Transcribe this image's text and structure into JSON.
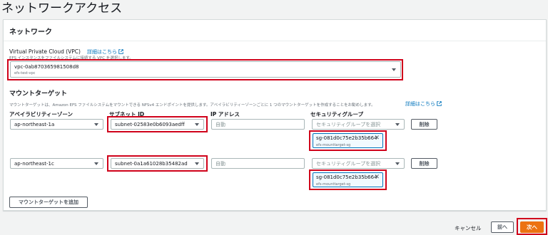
{
  "page": {
    "title": "ネットワークアクセス"
  },
  "network": {
    "header": "ネットワーク",
    "vpc_label": "Virtual Private Cloud (VPC)",
    "vpc_info_link": "詳細はこちら",
    "vpc_description": "EFS インスタンスをファイルシステムに接続する VPC を選択します。",
    "vpc_value": "vpc-0ab870365981508d8",
    "vpc_name": "efs-test-vpc"
  },
  "mount_targets": {
    "title": "マウントターゲット",
    "description": "マウントターゲットは、Amazon EFS ファイルシステムをマウントできる NFSv4 エンドポイントを提供します。アベイラビリティーゾーンごとに 1 つのマウントターゲットを作成することをお勧めします。",
    "info_link": "詳細はこちら",
    "col_az": "アベイラビリティーゾーン",
    "col_subnet": "サブネット ID",
    "col_ip": "IP アドレス",
    "col_sg": "セキュリティグループ",
    "rows": [
      {
        "az": "ap-northeast-1a",
        "subnet": "subnet-02583e0b6093aedff",
        "ip_placeholder": "自動",
        "sg_placeholder": "セキュリティグループを選択",
        "sg_token_id": "sg-081d0c75e2b35b664",
        "sg_token_name": "efs-mounttarget-sg",
        "remove_label": "削除"
      },
      {
        "az": "ap-northeast-1c",
        "subnet": "subnet-0a1a61028b35482ad",
        "ip_placeholder": "自動",
        "sg_placeholder": "セキュリティグループを選択",
        "sg_token_id": "sg-081d0c75e2b35b664",
        "sg_token_name": "efs-mounttarget-sg",
        "remove_label": "削除"
      }
    ],
    "add_button": "マウントターゲットを追加"
  },
  "footer": {
    "cancel": "キャンセル",
    "previous": "前へ",
    "next": "次へ"
  },
  "colors": {
    "accent": "#ec7211",
    "link": "#0073bb",
    "highlight": "#d0021b"
  },
  "icons": [
    "external-link-icon",
    "dropdown-caret-icon",
    "close-icon"
  ]
}
